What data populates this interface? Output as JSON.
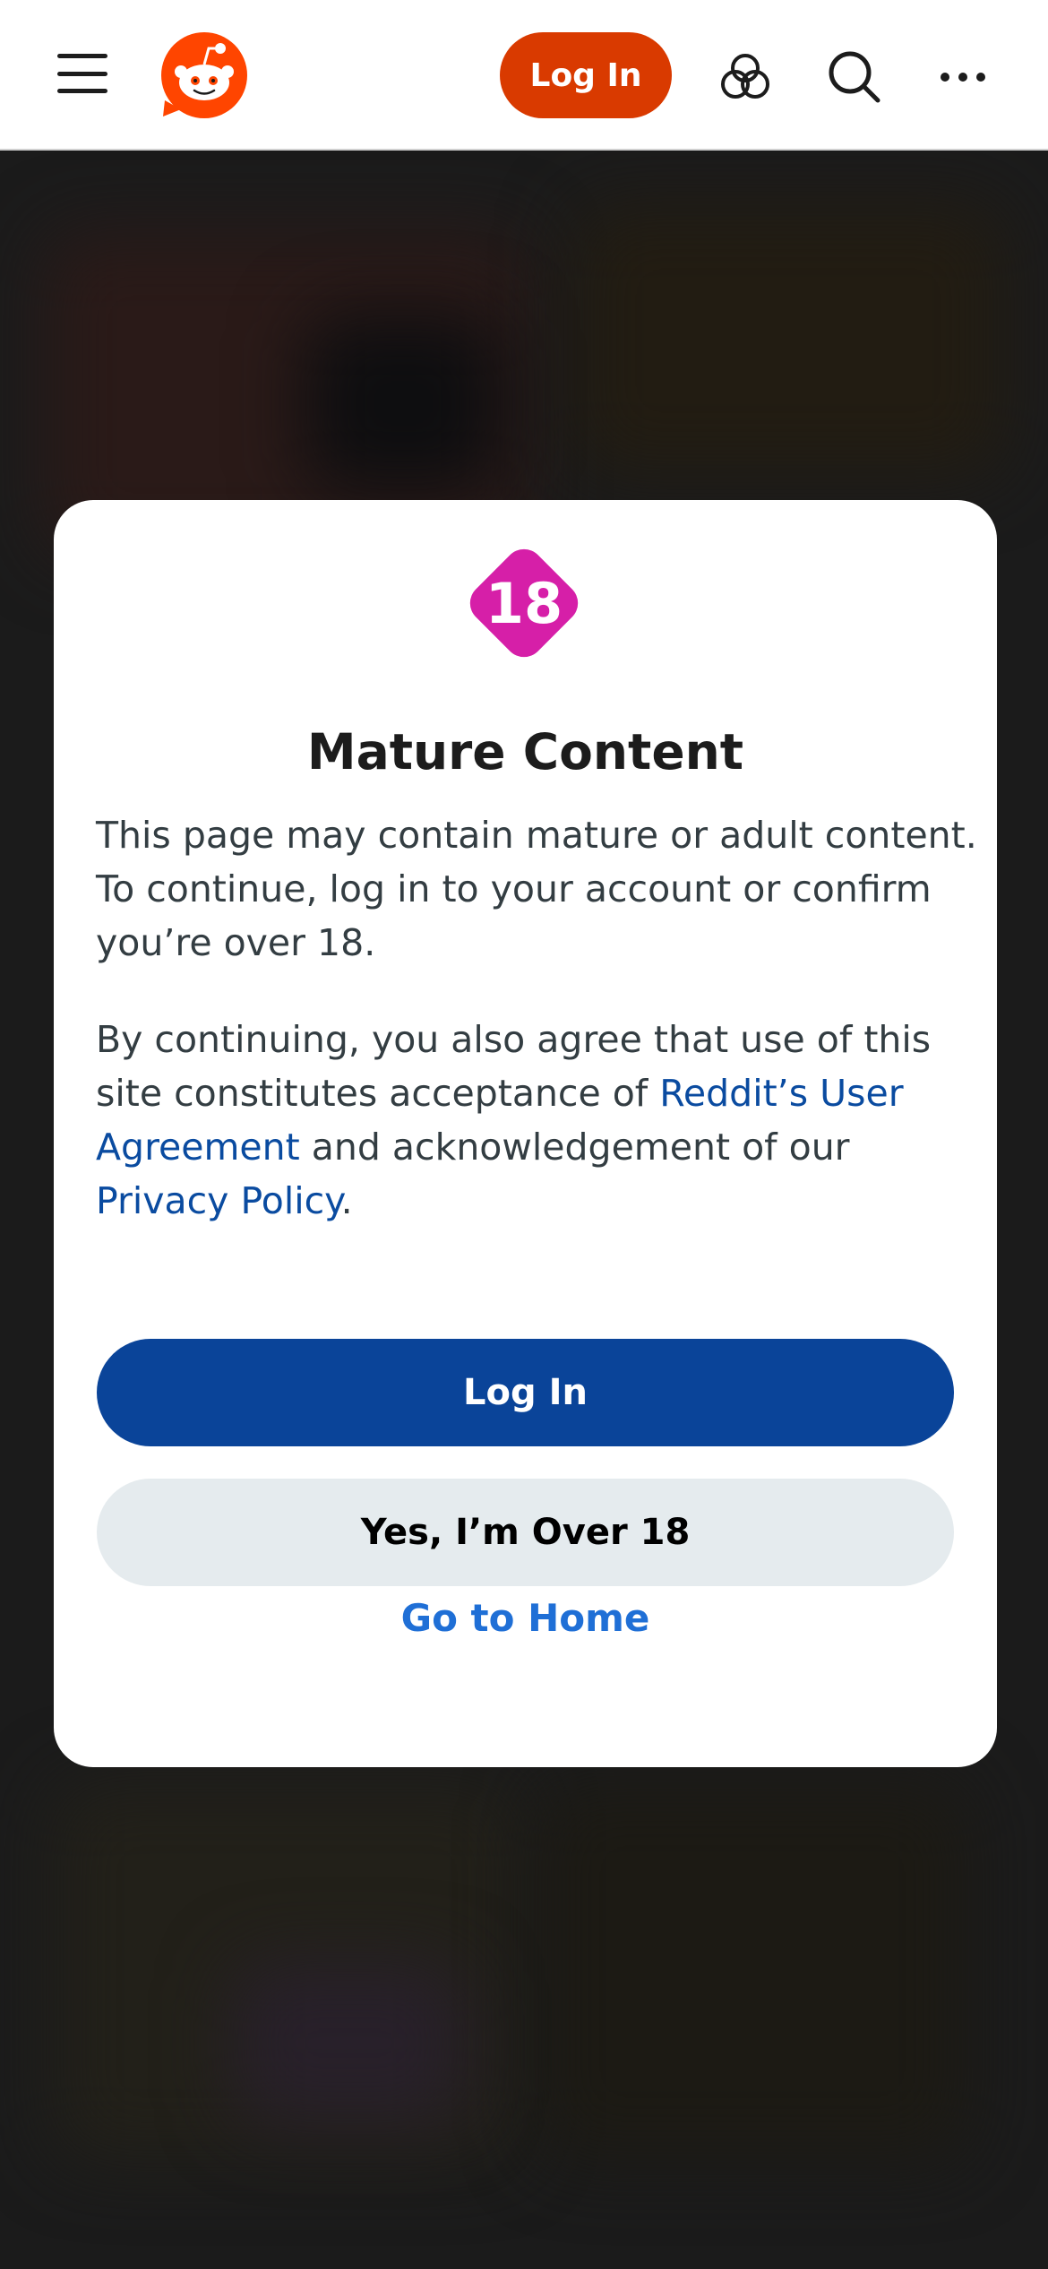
{
  "header": {
    "login_label": "Log In",
    "brand_color": "#d93a00",
    "icons": [
      "menu-icon",
      "reddit-logo",
      "chat-bubbles-icon",
      "search-icon",
      "more-icon"
    ]
  },
  "modal": {
    "badge_text": "18",
    "badge_color": "#d61fa8",
    "title": "Mature Content",
    "paragraph1": "This page may contain mature or adult content. To continue, log in to your account or confirm you’re over 18.",
    "paragraph2": {
      "part1": "By continuing, you also agree that use of this site constitutes acceptance of ",
      "user_agreement_link": "Reddit’s User Agreement",
      "part2": " and acknowledgement of our ",
      "privacy_link": "Privacy Policy",
      "part3": "."
    },
    "login_button": "Log In",
    "over18_button": "Yes, I’m Over 18",
    "home_link": "Go to Home"
  },
  "colors": {
    "primary_button": "#0a4499",
    "secondary_button": "#e5ebee",
    "link": "#0a4ba0",
    "home_link": "#1f6fd6"
  }
}
